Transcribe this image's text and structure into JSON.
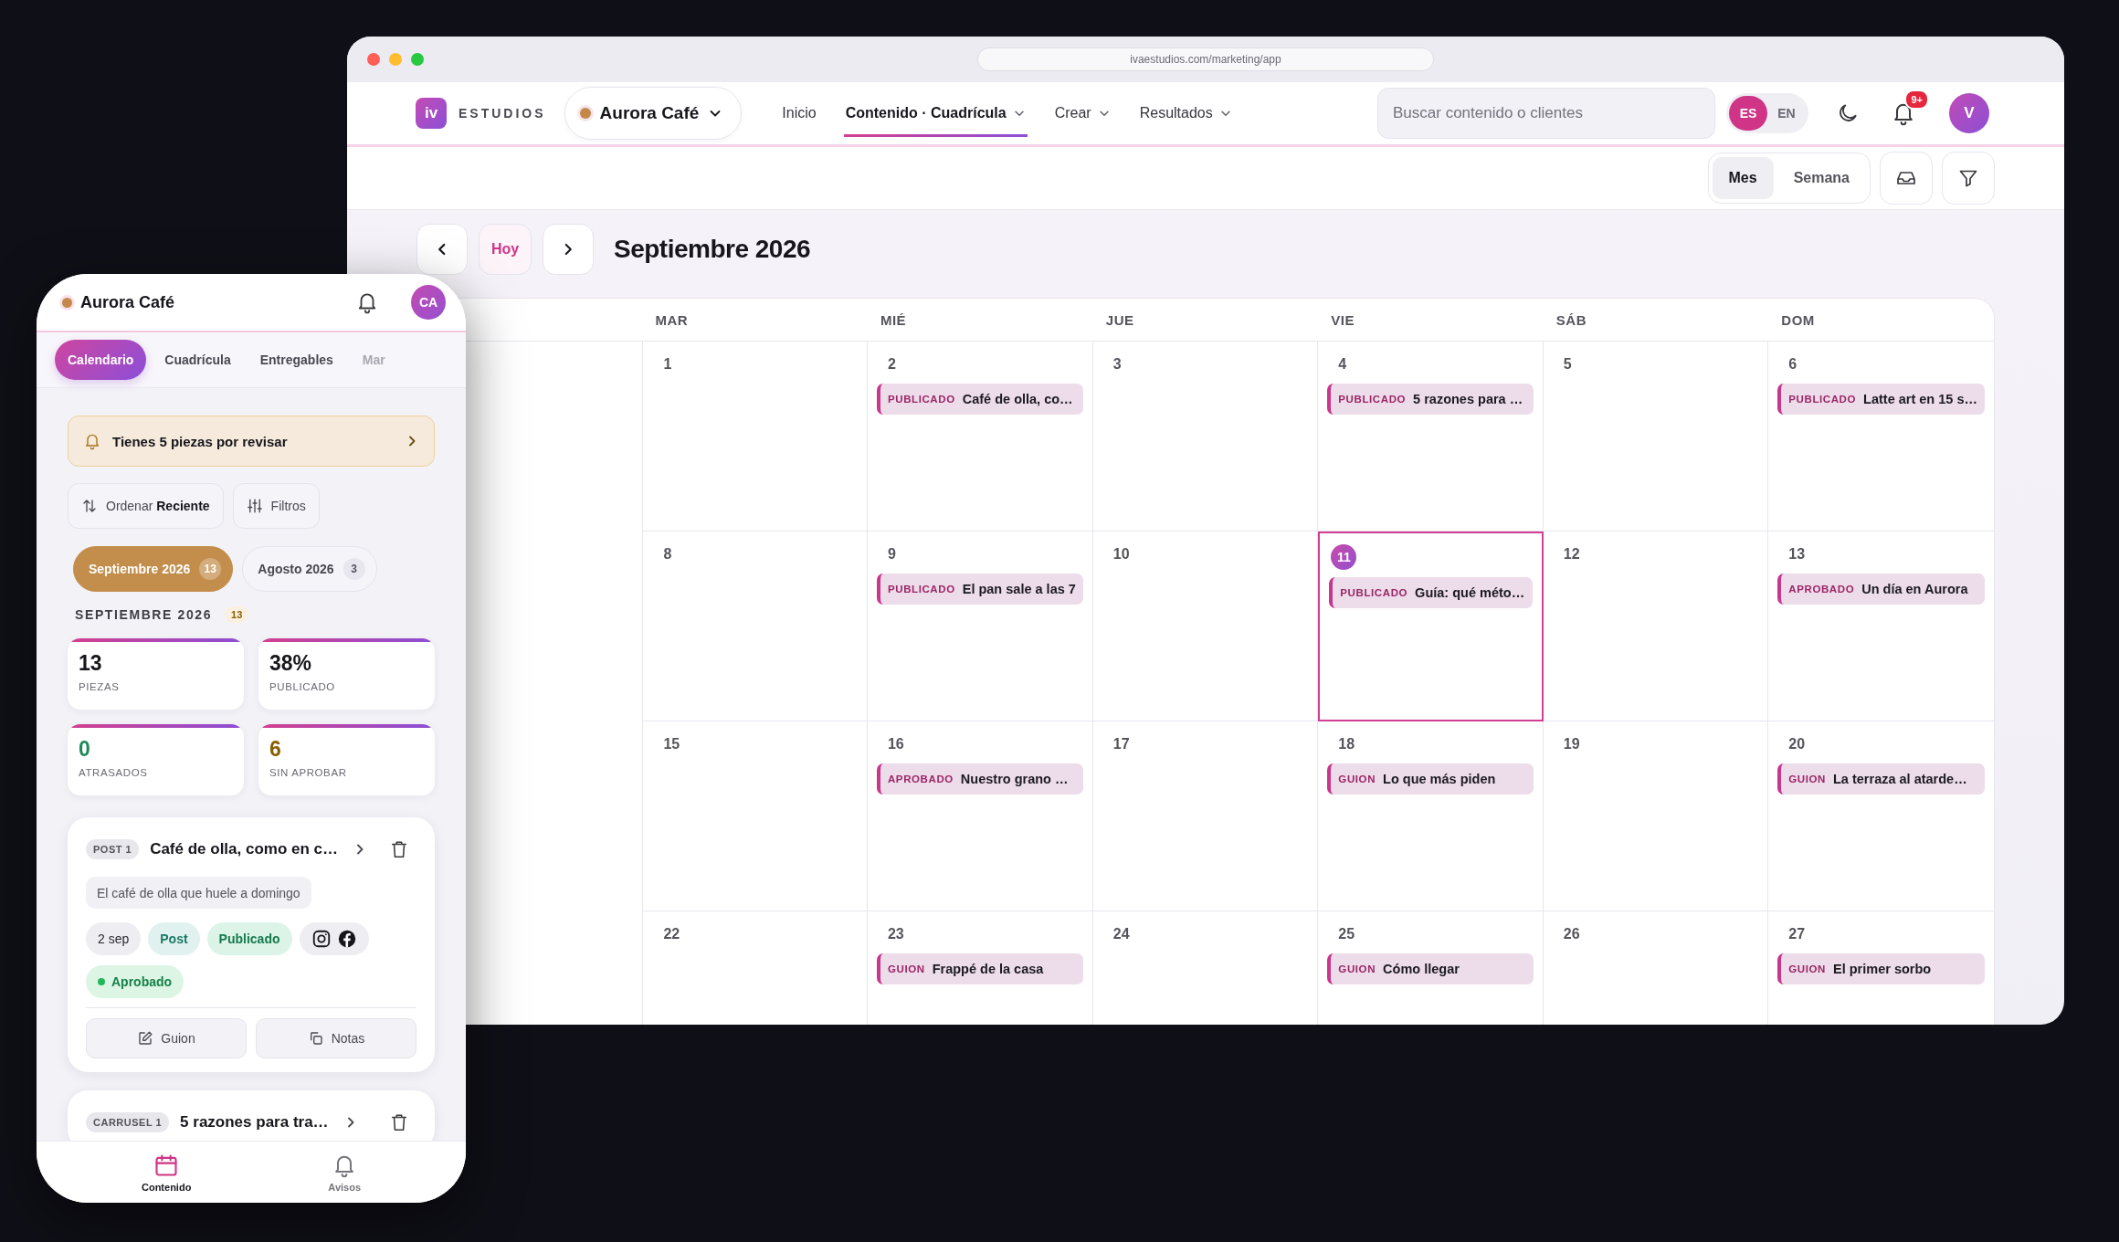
{
  "browser": {
    "url": "ivaestudios.com/marketing/app"
  },
  "nav": {
    "logo_mark": "iv",
    "brand": "ESTUDIOS",
    "client": "Aurora Café",
    "items": [
      {
        "label": "Inicio",
        "kind": "link",
        "selected": false
      },
      {
        "label": "Contenido · Cuadrícula",
        "kind": "menu",
        "selected": true
      },
      {
        "label": "Crear",
        "kind": "menu",
        "selected": false
      },
      {
        "label": "Resultados",
        "kind": "menu",
        "selected": false
      }
    ],
    "search": {
      "placeholder": "Buscar contenido o clientes"
    },
    "languages": [
      {
        "label": "ES",
        "selected": true
      },
      {
        "label": "EN",
        "selected": false
      }
    ],
    "notifications_badge": "9+",
    "avatar": "V"
  },
  "toolbar": {
    "views": [
      {
        "label": "Mes",
        "selected": true
      },
      {
        "label": "Semana",
        "selected": false
      }
    ]
  },
  "calendar": {
    "today_button": "Hoy",
    "title": "Septiembre 2026",
    "weekdays": [
      "MAR",
      "MIÉ",
      "JUE",
      "VIE",
      "SÁB",
      "DOM"
    ],
    "weeks": [
      {
        "days": [
          {
            "date": "1",
            "today": false
          },
          {
            "date": "2",
            "today": false,
            "events": [
              {
                "status": "PUBLICADO",
                "title": "Café de olla, co…"
              }
            ]
          },
          {
            "date": "3",
            "today": false
          },
          {
            "date": "4",
            "today": false,
            "events": [
              {
                "status": "PUBLICADO",
                "title": "5 razones para …"
              }
            ]
          },
          {
            "date": "5",
            "today": false
          },
          {
            "date": "6",
            "today": false,
            "events": [
              {
                "status": "PUBLICADO",
                "title": "Latte art en 15 s…"
              }
            ]
          }
        ]
      },
      {
        "days": [
          {
            "date": "8",
            "today": false
          },
          {
            "date": "9",
            "today": false,
            "events": [
              {
                "status": "PUBLICADO",
                "title": "El pan sale a las 7"
              }
            ]
          },
          {
            "date": "10",
            "today": false
          },
          {
            "date": "11",
            "today": true,
            "events": [
              {
                "status": "PUBLICADO",
                "title": "Guía: qué méto…"
              }
            ]
          },
          {
            "date": "12",
            "today": false
          },
          {
            "date": "13",
            "today": false,
            "events": [
              {
                "status": "APROBADO",
                "title": "Un día en Aurora"
              }
            ]
          }
        ]
      },
      {
        "days": [
          {
            "date": "15",
            "today": false
          },
          {
            "date": "16",
            "today": false,
            "events": [
              {
                "status": "APROBADO",
                "title": "Nuestro grano …"
              }
            ]
          },
          {
            "date": "17",
            "today": false
          },
          {
            "date": "18",
            "today": false,
            "events": [
              {
                "status": "GUION",
                "title": "Lo que más piden"
              }
            ]
          },
          {
            "date": "19",
            "today": false
          },
          {
            "date": "20",
            "today": false,
            "events": [
              {
                "status": "GUION",
                "title": "La terraza al atarde…"
              }
            ]
          }
        ]
      },
      {
        "days": [
          {
            "date": "22",
            "today": false
          },
          {
            "date": "23",
            "today": false,
            "events": [
              {
                "status": "GUION",
                "title": "Frappé de la casa"
              }
            ]
          },
          {
            "date": "24",
            "today": false
          },
          {
            "date": "25",
            "today": false,
            "events": [
              {
                "status": "GUION",
                "title": "Cómo llegar"
              }
            ]
          },
          {
            "date": "26",
            "today": false
          },
          {
            "date": "27",
            "today": false,
            "events": [
              {
                "status": "GUION",
                "title": "El primer sorbo"
              }
            ]
          }
        ]
      }
    ]
  },
  "phone": {
    "client": "Aurora Café",
    "avatar": "CA",
    "tabs": [
      {
        "label": "Calendario",
        "selected": true
      },
      {
        "label": "Cuadrícula",
        "selected": false
      },
      {
        "label": "Entregables",
        "selected": false
      },
      {
        "label": "Mar",
        "selected": false
      }
    ],
    "alert": "Tienes 5 piezas por revisar",
    "sort_button": "Ordenar **Reciente**",
    "filter_button": "Filtros",
    "months": [
      {
        "label": "Septiembre 2026",
        "count": "13",
        "selected": true
      },
      {
        "label": "Agosto 2026",
        "count": "3",
        "selected": false
      }
    ],
    "section": {
      "title": "SEPTIEMBRE 2026",
      "count": "13"
    },
    "stats": [
      {
        "value": "13",
        "label": "PIEZAS",
        "color": "#17161c"
      },
      {
        "value": "38%",
        "label": "PUBLICADO",
        "color": "#17161c"
      },
      {
        "value": "0",
        "label": "ATRASADOS",
        "color": "#1d8a57"
      },
      {
        "value": "6",
        "label": "SIN APROBAR",
        "color": "#8a5e00"
      }
    ],
    "pieces": [
      {
        "tag": "POST 1",
        "title": "Café de olla, como en c…",
        "hook": "El café de olla que huele a domingo",
        "chips": [
          {
            "kind": "date",
            "label": "2 sep"
          },
          {
            "kind": "type",
            "label": "Post"
          },
          {
            "kind": "status",
            "label": "Publicado"
          },
          {
            "kind": "networks"
          },
          {
            "kind": "approval",
            "label": "Aprobado"
          }
        ],
        "actions": [
          {
            "kind": "script",
            "label": "Guion"
          },
          {
            "kind": "notes",
            "label": "Notas"
          }
        ]
      },
      {
        "tag": "CARRUSEL 1",
        "title": "5 razones para tra…"
      }
    ],
    "bottom_nav": [
      {
        "kind": "content",
        "label": "Contenido",
        "selected": true
      },
      {
        "kind": "alerts",
        "label": "Avisos",
        "selected": false
      }
    ]
  }
}
